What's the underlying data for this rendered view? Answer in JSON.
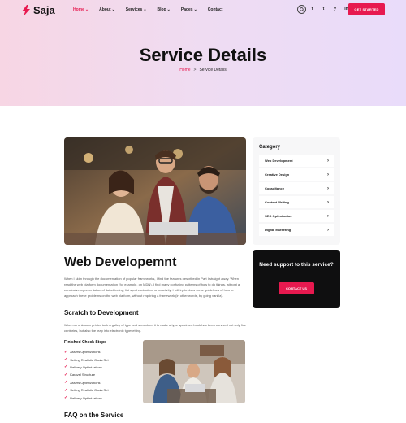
{
  "header": {
    "logo_text": "Saja",
    "nav": [
      {
        "label": "Home",
        "chevron": true
      },
      {
        "label": "About",
        "chevron": true
      },
      {
        "label": "Services",
        "chevron": true
      },
      {
        "label": "Blog",
        "chevron": true
      },
      {
        "label": "Pages",
        "chevron": true
      },
      {
        "label": "Contact",
        "chevron": false
      }
    ],
    "socials": [
      "f",
      "t",
      "y",
      "in"
    ],
    "cta_label": "GET STARTED"
  },
  "hero": {
    "title": "Service Details",
    "breadcrumb_home": "Home",
    "breadcrumb_sep": ">",
    "breadcrumb_current": "Service Details"
  },
  "content": {
    "title": "Web Developemnt",
    "intro": "When I skim through the documentation of popular frameworks, I find the features described in Part I straight away. When I read the web platform documentation (for example, on MDN), I find many confusing patterns of how to do things, without a conclusive representation of data-binding, list synchronization, or reactivity. I will try to draw some guidelines of how to approach these problems on the web platform, without requiring a framework (in other words, by going vanilla).",
    "scratch_title": "Scratch to Development",
    "scratch_text": "When an unknown printer took a galley of type and scrambled it to make a type specimen book has been survived not only five centuries, but also the leap into electronic typesetting.",
    "steps_title": "Finished Check Steps",
    "steps": [
      "Assets Optimizations",
      "Setting Realistic Goals Set",
      "Delivery Optimizations",
      "Karavel Structure",
      "Assets Optimizations",
      "Setting Realistic Goals Set",
      "Delivery Optimizations"
    ],
    "faq_title": "FAQ on the Service"
  },
  "sidebar": {
    "category_title": "Category",
    "categories": [
      "Web Development",
      "Creative Design",
      "Consultancy",
      "Content Writing",
      "SEO Optimization",
      "Digital Marketing"
    ],
    "support_text": "Need support to this service?",
    "support_button": "CONTACT US"
  },
  "colors": {
    "accent": "#e7194f",
    "dark": "#0f0f10"
  }
}
